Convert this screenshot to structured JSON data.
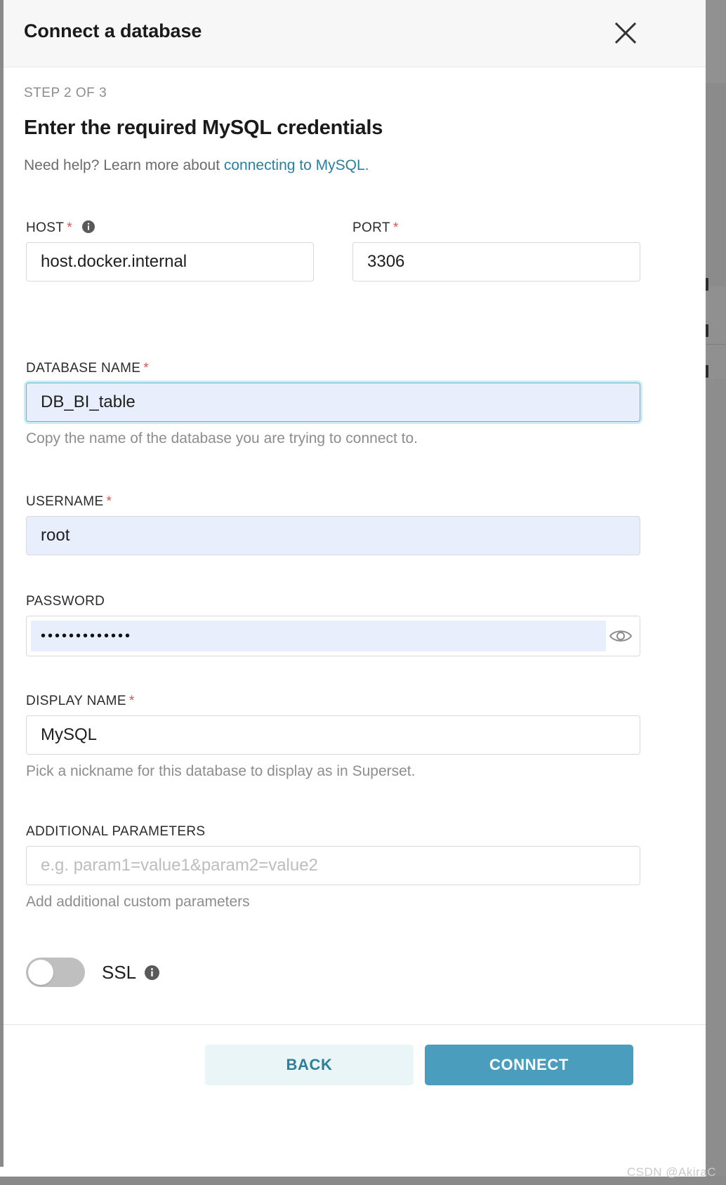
{
  "modal": {
    "title": "Connect a database",
    "close_icon": "close-icon"
  },
  "step": {
    "label": "STEP 2 OF 3",
    "heading": "Enter the required MySQL credentials",
    "help_prefix": "Need help? Learn more about ",
    "help_link": "connecting to MySQL.",
    "link_color": "#2a7f9e"
  },
  "fields": {
    "host": {
      "label": "HOST",
      "required": "*",
      "value": "host.docker.internal",
      "placeholder": "",
      "has_info_icon": true,
      "info_icon": "info-circle-icon"
    },
    "port": {
      "label": "PORT",
      "required": "*",
      "value": "3306",
      "placeholder": ""
    },
    "database_name": {
      "label": "DATABASE NAME",
      "required": "*",
      "value": "DB_BI_table",
      "placeholder": "",
      "helper": "Copy the name of the database you are trying to connect to.",
      "focused": true
    },
    "username": {
      "label": "USERNAME",
      "required": "*",
      "value": "root",
      "placeholder": ""
    },
    "password": {
      "label": "PASSWORD",
      "required": "",
      "value": "•••••••••••••",
      "masked_char_count": 13,
      "reveal_icon": "eye-icon"
    },
    "display_name": {
      "label": "DISPLAY NAME",
      "required": "*",
      "value": "MySQL",
      "placeholder": "",
      "helper": "Pick a nickname for this database to display as in Superset."
    },
    "additional_parameters": {
      "label": "ADDITIONAL PARAMETERS",
      "required": "",
      "value": "",
      "placeholder": "e.g. param1=value1&param2=value2",
      "helper": "Add additional custom parameters"
    },
    "ssl": {
      "label": "SSL",
      "state": "off",
      "info_icon": "info-circle-icon"
    }
  },
  "footer": {
    "back_label": "BACK",
    "connect_label": "CONNECT",
    "back_bg": "#e9f5f7",
    "back_fg": "#2f7f99",
    "connect_bg": "#4a9dbd",
    "connect_fg": "#ffffff"
  },
  "watermark": "CSDN @AkiraC"
}
